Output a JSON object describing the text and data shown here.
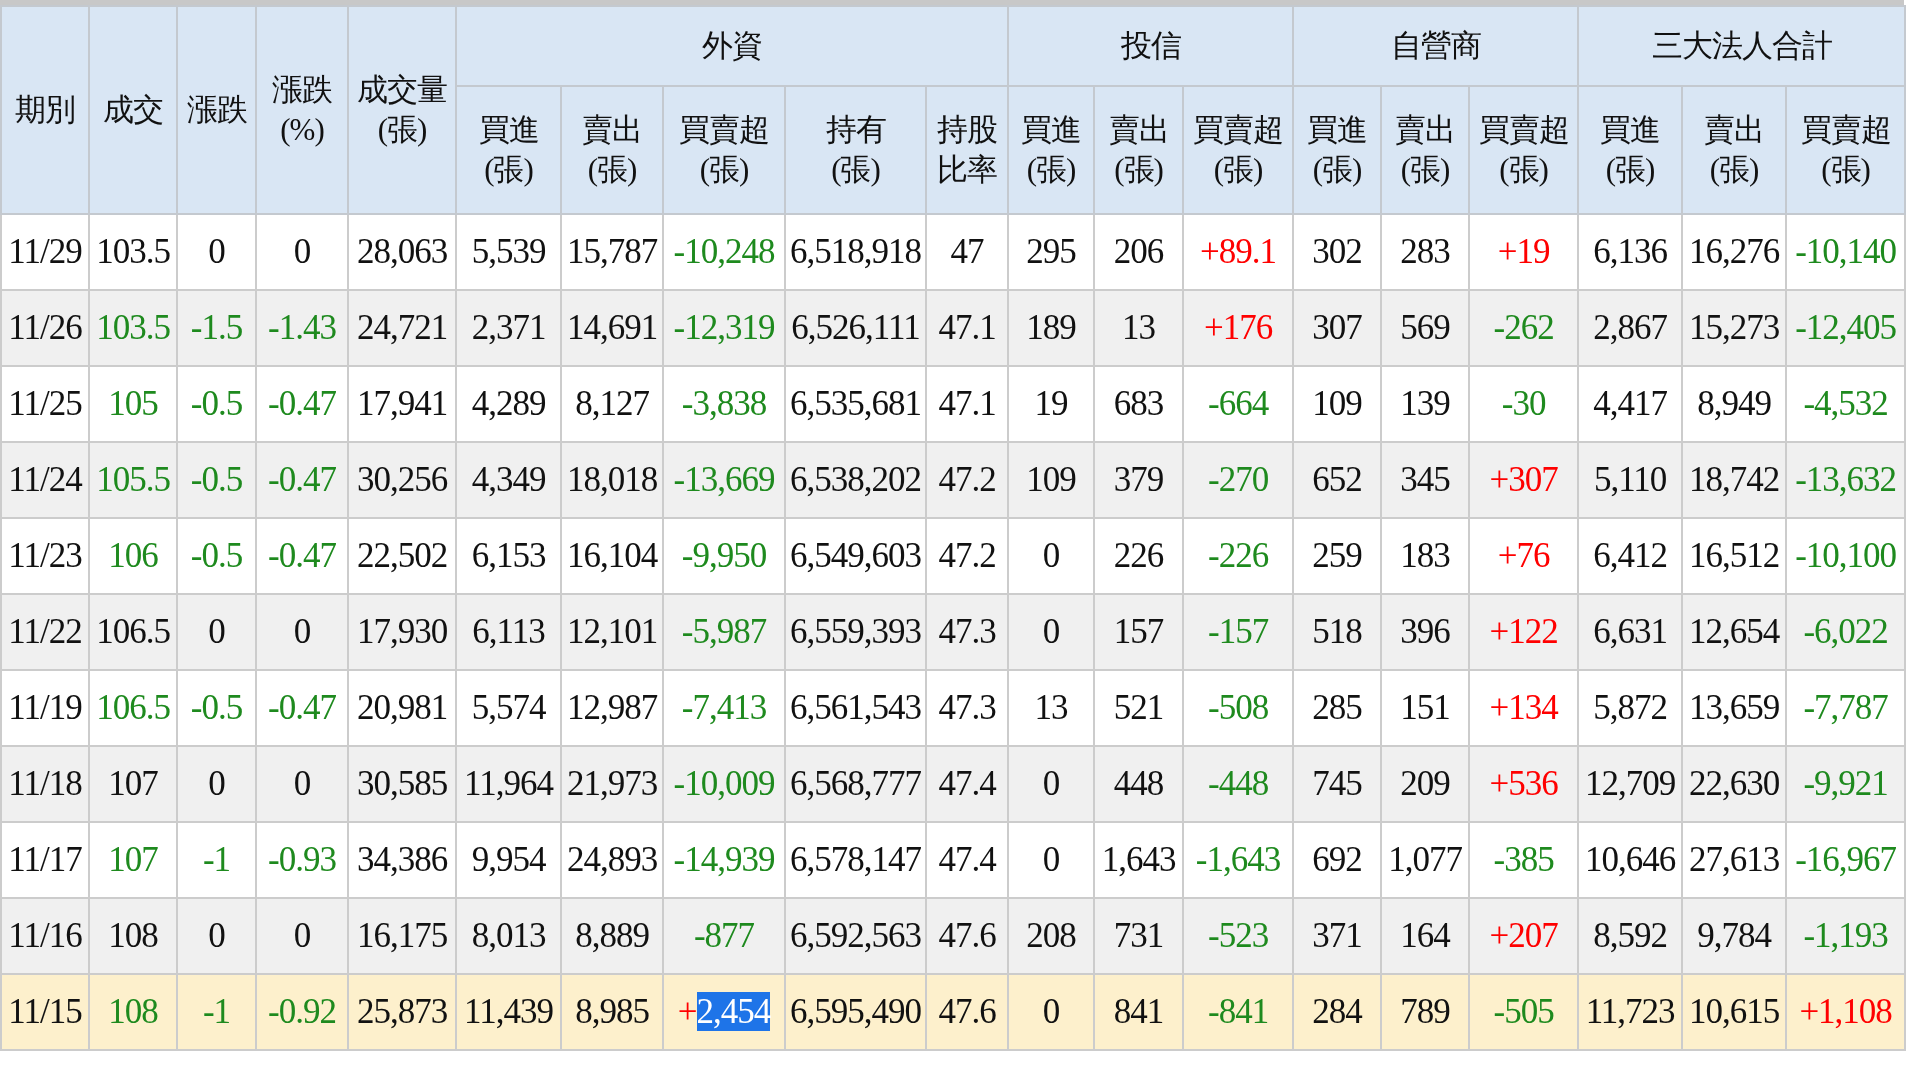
{
  "table": {
    "lead_columns": [
      {
        "label": "期別"
      },
      {
        "label": "成交"
      },
      {
        "label": "漲跌"
      },
      {
        "label": "漲跌",
        "unit": "(%)"
      },
      {
        "label": "成交量",
        "unit": "(張)"
      }
    ],
    "groups": [
      {
        "label": "外資",
        "columns": [
          {
            "label": "買進",
            "unit": "(張)"
          },
          {
            "label": "賣出",
            "unit": "(張)"
          },
          {
            "label": "買賣超",
            "unit": "(張)"
          },
          {
            "label": "持有",
            "unit": "(張)"
          },
          {
            "label": "持股比率"
          }
        ]
      },
      {
        "label": "投信",
        "columns": [
          {
            "label": "買進",
            "unit": "(張)"
          },
          {
            "label": "賣出",
            "unit": "(張)"
          },
          {
            "label": "買賣超",
            "unit": "(張)"
          }
        ]
      },
      {
        "label": "自營商",
        "columns": [
          {
            "label": "買進",
            "unit": "(張)"
          },
          {
            "label": "賣出",
            "unit": "(張)"
          },
          {
            "label": "買賣超",
            "unit": "(張)"
          }
        ]
      },
      {
        "label": "三大法人合計",
        "columns": [
          {
            "label": "買進",
            "unit": "(張)"
          },
          {
            "label": "賣出",
            "unit": "(張)"
          },
          {
            "label": "買賣超",
            "unit": "(張)"
          }
        ]
      }
    ],
    "rows": [
      {
        "selected": false,
        "cells": [
          "11/29",
          "103.5",
          "0",
          "0",
          "28,063",
          "5,539",
          "15,787",
          {
            "text": "-10,248",
            "color": "#1e8a1e"
          },
          "6,518,918",
          "47",
          "295",
          "206",
          {
            "text": "+89.1",
            "color": "#ff0000"
          },
          "302",
          "283",
          {
            "text": "+19",
            "color": "#ff0000"
          },
          "6,136",
          "16,276",
          {
            "text": "-10,140",
            "color": "#1e8a1e"
          }
        ]
      },
      {
        "selected": false,
        "cells": [
          "11/26",
          {
            "text": "103.5",
            "color": "#1e8a1e"
          },
          {
            "text": "-1.5",
            "color": "#1e8a1e"
          },
          {
            "text": "-1.43",
            "color": "#1e8a1e"
          },
          "24,721",
          "2,371",
          "14,691",
          {
            "text": "-12,319",
            "color": "#1e8a1e"
          },
          "6,526,111",
          "47.1",
          "189",
          "13",
          {
            "text": "+176",
            "color": "#ff0000"
          },
          "307",
          "569",
          {
            "text": "-262",
            "color": "#1e8a1e"
          },
          "2,867",
          "15,273",
          {
            "text": "-12,405",
            "color": "#1e8a1e"
          }
        ]
      },
      {
        "selected": false,
        "cells": [
          "11/25",
          {
            "text": "105",
            "color": "#1e8a1e"
          },
          {
            "text": "-0.5",
            "color": "#1e8a1e"
          },
          {
            "text": "-0.47",
            "color": "#1e8a1e"
          },
          "17,941",
          "4,289",
          "8,127",
          {
            "text": "-3,838",
            "color": "#1e8a1e"
          },
          "6,535,681",
          "47.1",
          "19",
          "683",
          {
            "text": "-664",
            "color": "#1e8a1e"
          },
          "109",
          "139",
          {
            "text": "-30",
            "color": "#1e8a1e"
          },
          "4,417",
          "8,949",
          {
            "text": "-4,532",
            "color": "#1e8a1e"
          }
        ]
      },
      {
        "selected": false,
        "cells": [
          "11/24",
          {
            "text": "105.5",
            "color": "#1e8a1e"
          },
          {
            "text": "-0.5",
            "color": "#1e8a1e"
          },
          {
            "text": "-0.47",
            "color": "#1e8a1e"
          },
          "30,256",
          "4,349",
          "18,018",
          {
            "text": "-13,669",
            "color": "#1e8a1e"
          },
          "6,538,202",
          "47.2",
          "109",
          "379",
          {
            "text": "-270",
            "color": "#1e8a1e"
          },
          "652",
          "345",
          {
            "text": "+307",
            "color": "#ff0000"
          },
          "5,110",
          "18,742",
          {
            "text": "-13,632",
            "color": "#1e8a1e"
          }
        ]
      },
      {
        "selected": false,
        "cells": [
          "11/23",
          {
            "text": "106",
            "color": "#1e8a1e"
          },
          {
            "text": "-0.5",
            "color": "#1e8a1e"
          },
          {
            "text": "-0.47",
            "color": "#1e8a1e"
          },
          "22,502",
          "6,153",
          "16,104",
          {
            "text": "-9,950",
            "color": "#1e8a1e"
          },
          "6,549,603",
          "47.2",
          "0",
          "226",
          {
            "text": "-226",
            "color": "#1e8a1e"
          },
          "259",
          "183",
          {
            "text": "+76",
            "color": "#ff0000"
          },
          "6,412",
          "16,512",
          {
            "text": "-10,100",
            "color": "#1e8a1e"
          }
        ]
      },
      {
        "selected": false,
        "cells": [
          "11/22",
          "106.5",
          "0",
          "0",
          "17,930",
          "6,113",
          "12,101",
          {
            "text": "-5,987",
            "color": "#1e8a1e"
          },
          "6,559,393",
          "47.3",
          "0",
          "157",
          {
            "text": "-157",
            "color": "#1e8a1e"
          },
          "518",
          "396",
          {
            "text": "+122",
            "color": "#ff0000"
          },
          "6,631",
          "12,654",
          {
            "text": "-6,022",
            "color": "#1e8a1e"
          }
        ]
      },
      {
        "selected": false,
        "cells": [
          "11/19",
          {
            "text": "106.5",
            "color": "#1e8a1e"
          },
          {
            "text": "-0.5",
            "color": "#1e8a1e"
          },
          {
            "text": "-0.47",
            "color": "#1e8a1e"
          },
          "20,981",
          "5,574",
          "12,987",
          {
            "text": "-7,413",
            "color": "#1e8a1e"
          },
          "6,561,543",
          "47.3",
          "13",
          "521",
          {
            "text": "-508",
            "color": "#1e8a1e"
          },
          "285",
          "151",
          {
            "text": "+134",
            "color": "#ff0000"
          },
          "5,872",
          "13,659",
          {
            "text": "-7,787",
            "color": "#1e8a1e"
          }
        ]
      },
      {
        "selected": false,
        "cells": [
          "11/18",
          "107",
          "0",
          "0",
          "30,585",
          "11,964",
          "21,973",
          {
            "text": "-10,009",
            "color": "#1e8a1e"
          },
          "6,568,777",
          "47.4",
          "0",
          "448",
          {
            "text": "-448",
            "color": "#1e8a1e"
          },
          "745",
          "209",
          {
            "text": "+536",
            "color": "#ff0000"
          },
          "12,709",
          "22,630",
          {
            "text": "-9,921",
            "color": "#1e8a1e"
          }
        ]
      },
      {
        "selected": false,
        "cells": [
          "11/17",
          {
            "text": "107",
            "color": "#1e8a1e"
          },
          {
            "text": "-1",
            "color": "#1e8a1e"
          },
          {
            "text": "-0.93",
            "color": "#1e8a1e"
          },
          "34,386",
          "9,954",
          "24,893",
          {
            "text": "-14,939",
            "color": "#1e8a1e"
          },
          "6,578,147",
          "47.4",
          "0",
          "1,643",
          {
            "text": "-1,643",
            "color": "#1e8a1e"
          },
          "692",
          "1,077",
          {
            "text": "-385",
            "color": "#1e8a1e"
          },
          "10,646",
          "27,613",
          {
            "text": "-16,967",
            "color": "#1e8a1e"
          }
        ]
      },
      {
        "selected": false,
        "cells": [
          "11/16",
          "108",
          "0",
          "0",
          "16,175",
          "8,013",
          "8,889",
          {
            "text": "-877",
            "color": "#1e8a1e"
          },
          "6,592,563",
          "47.6",
          "208",
          "731",
          {
            "text": "-523",
            "color": "#1e8a1e"
          },
          "371",
          "164",
          {
            "text": "+207",
            "color": "#ff0000"
          },
          "8,592",
          "9,784",
          {
            "text": "-1,193",
            "color": "#1e8a1e"
          }
        ]
      },
      {
        "selected": true,
        "cells": [
          "11/15",
          {
            "text": "108",
            "color": "#1e8a1e"
          },
          {
            "text": "-1",
            "color": "#1e8a1e"
          },
          {
            "text": "-0.92",
            "color": "#1e8a1e"
          },
          "25,873",
          "11,439",
          "8,985",
          {
            "color": "#ff0000",
            "parts": [
              {
                "text": "+",
                "highlighted": false
              },
              {
                "text": "2,454",
                "highlighted": true
              }
            ]
          },
          "6,595,490",
          "47.6",
          "0",
          "841",
          {
            "text": "-841",
            "color": "#1e8a1e"
          },
          "284",
          "789",
          {
            "text": "-505",
            "color": "#1e8a1e"
          },
          "11,723",
          "10,615",
          {
            "text": "+1,108",
            "color": "#ff0000"
          }
        ]
      }
    ]
  }
}
